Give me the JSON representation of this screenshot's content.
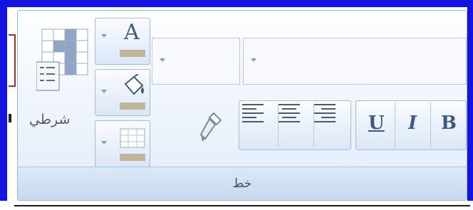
{
  "ribbon": {
    "group_label": "خط",
    "conditional_formatting_label": "شرطي"
  },
  "font": {
    "size_value": "",
    "name_value": ""
  },
  "buttons": {
    "bold": "B",
    "italic": "I",
    "underline": "U",
    "font_color": "A"
  },
  "icons": {
    "conditional_formatting": "conditional-formatting-icon",
    "font_color": "font-color-icon",
    "fill_color": "paint-bucket-icon",
    "borders": "borders-icon",
    "format_painter": "paint-brush-icon",
    "align_left": "align-left-icon",
    "align_center": "align-center-icon",
    "align_right": "align-right-icon"
  },
  "colors": {
    "window_frame": "#1414e0",
    "ribbon_border": "#9bb6d8",
    "button_text": "#3d5a86",
    "swatch": "#c0b49a"
  }
}
